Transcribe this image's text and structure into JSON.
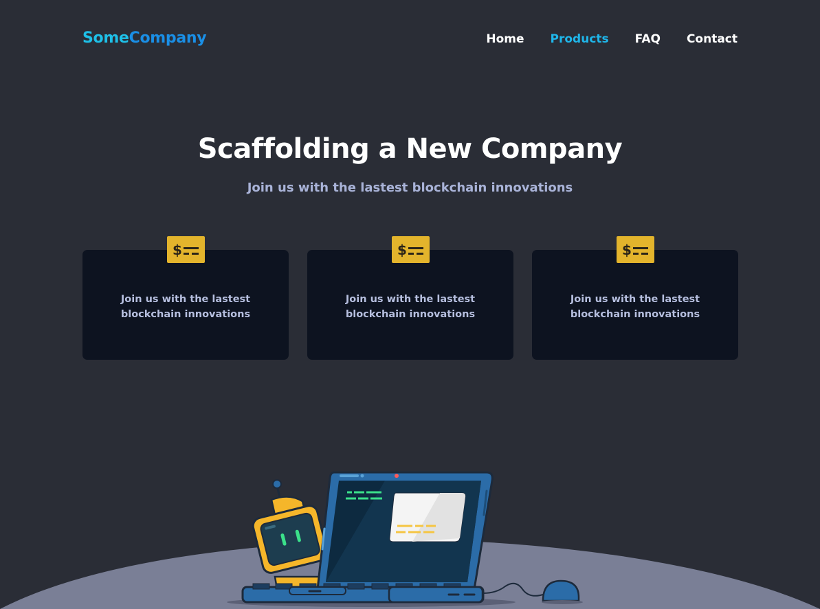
{
  "header": {
    "logo_part1": "Some",
    "logo_part2": "Company",
    "nav": [
      {
        "label": "Home",
        "active": false
      },
      {
        "label": "Products",
        "active": true
      },
      {
        "label": "FAQ",
        "active": false
      },
      {
        "label": "Contact",
        "active": false
      }
    ]
  },
  "hero": {
    "title": "Scaffolding a New Company",
    "subtitle": "Join us with the lastest blockchain innovations"
  },
  "cards": [
    {
      "icon": "payment-card-icon",
      "text": "Join us with the lastest blockchain innovations"
    },
    {
      "icon": "payment-card-icon",
      "text": "Join us with the lastest blockchain innovations"
    },
    {
      "icon": "payment-card-icon",
      "text": "Join us with the lastest blockchain innovations"
    }
  ],
  "illustration": {
    "name": "robot-laptop-illustration",
    "colors": {
      "ground": "#7a7f96",
      "laptop": "#2b6ca8",
      "robot": "#f5b62a",
      "accent_green": "#3be08a"
    }
  },
  "colors": {
    "background": "#2a2d36",
    "card_background": "#0d1320",
    "accent": "#1fb6ea",
    "icon_background": "#e3b42c"
  }
}
